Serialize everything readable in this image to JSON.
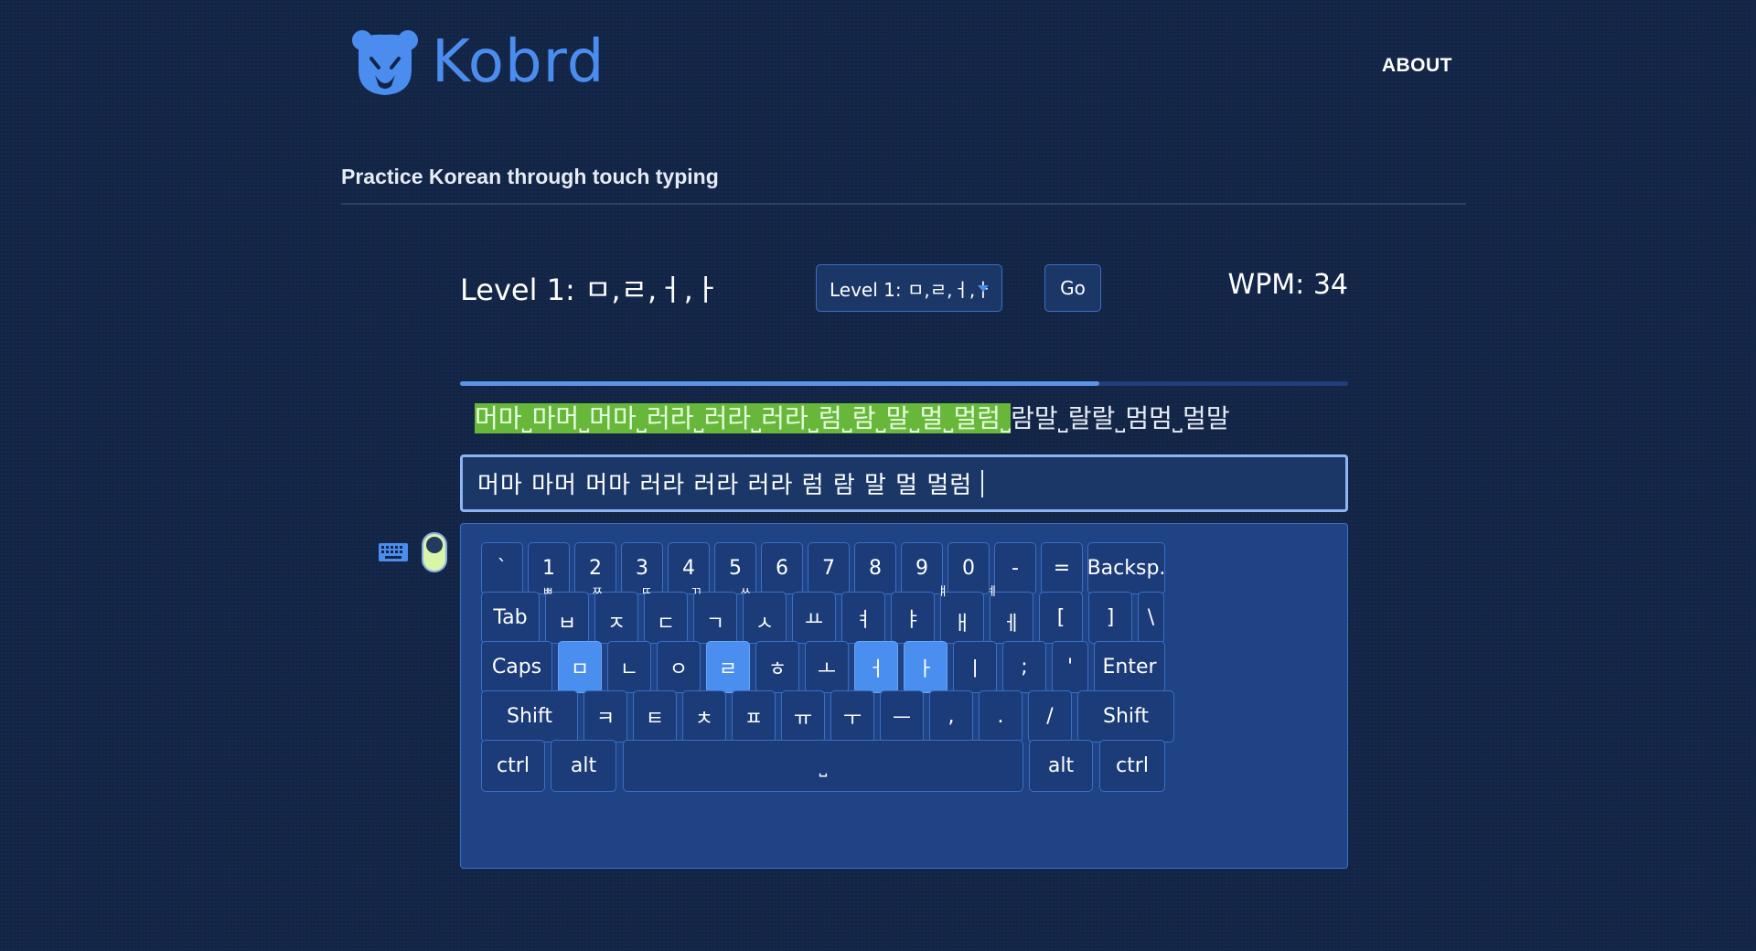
{
  "header": {
    "brand": "Kobrd",
    "about_label": "ABOUT",
    "tagline": "Practice Korean through touch typing"
  },
  "level": {
    "title": "Level 1: ㅁ,ㄹ,ㅓ,ㅏ",
    "selected_option": "Level 1: ㅁ,ㄹ,ㅓ,ㅏ",
    "go_label": "Go",
    "wpm_text": "WPM: 34"
  },
  "progress": {
    "fraction": 0.72
  },
  "target": {
    "completed": "머마˽마머˽머마˽러라˽러라˽러라˽럼˽람˽말˽멀˽멀럼˽",
    "remaining": "람말˽랄랄˽멈멈˽멀말"
  },
  "input": {
    "value": "머마 마머 머마 러라 러라 러라 럼 람 말 멀 멀럼"
  },
  "toggle": {
    "on": true
  },
  "colors": {
    "accent": "#4a8dee",
    "completed_bg": "#67b83a",
    "background": "#132546"
  },
  "keyboard": {
    "rows": [
      [
        {
          "label": "`"
        },
        {
          "label": "1"
        },
        {
          "label": "2"
        },
        {
          "label": "3"
        },
        {
          "label": "4"
        },
        {
          "label": "5"
        },
        {
          "label": "6"
        },
        {
          "label": "7"
        },
        {
          "label": "8"
        },
        {
          "label": "9"
        },
        {
          "label": "0"
        },
        {
          "label": "-"
        },
        {
          "label": "="
        },
        {
          "label": "Backsp."
        }
      ],
      [
        {
          "label": "Tab"
        },
        {
          "label": "ㅂ",
          "shift": "ㅃ"
        },
        {
          "label": "ㅈ",
          "shift": "ㅉ"
        },
        {
          "label": "ㄷ",
          "shift": "ㄸ"
        },
        {
          "label": "ㄱ",
          "shift": "ㄲ"
        },
        {
          "label": "ㅅ",
          "shift": "ㅆ"
        },
        {
          "label": "ㅛ"
        },
        {
          "label": "ㅕ"
        },
        {
          "label": "ㅑ"
        },
        {
          "label": "ㅐ",
          "shift": "ㅒ"
        },
        {
          "label": "ㅔ",
          "shift": "ㅖ"
        },
        {
          "label": "["
        },
        {
          "label": "]"
        },
        {
          "label": "\\"
        }
      ],
      [
        {
          "label": "Caps"
        },
        {
          "label": "ㅁ",
          "lit": true
        },
        {
          "label": "ㄴ"
        },
        {
          "label": "ㅇ"
        },
        {
          "label": "ㄹ",
          "lit": true
        },
        {
          "label": "ㅎ"
        },
        {
          "label": "ㅗ"
        },
        {
          "label": "ㅓ",
          "lit": true
        },
        {
          "label": "ㅏ",
          "lit": true
        },
        {
          "label": "ㅣ"
        },
        {
          "label": ";"
        },
        {
          "label": "'"
        },
        {
          "label": "Enter"
        }
      ],
      [
        {
          "label": "Shift"
        },
        {
          "label": "ㅋ"
        },
        {
          "label": "ㅌ"
        },
        {
          "label": "ㅊ"
        },
        {
          "label": "ㅍ"
        },
        {
          "label": "ㅠ"
        },
        {
          "label": "ㅜ"
        },
        {
          "label": "ㅡ"
        },
        {
          "label": ","
        },
        {
          "label": "."
        },
        {
          "label": "/"
        },
        {
          "label": "Shift"
        }
      ],
      [
        {
          "label": "ctrl"
        },
        {
          "label": "alt"
        },
        {
          "label": "˽"
        },
        {
          "label": "alt"
        },
        {
          "label": "ctrl"
        }
      ]
    ]
  }
}
